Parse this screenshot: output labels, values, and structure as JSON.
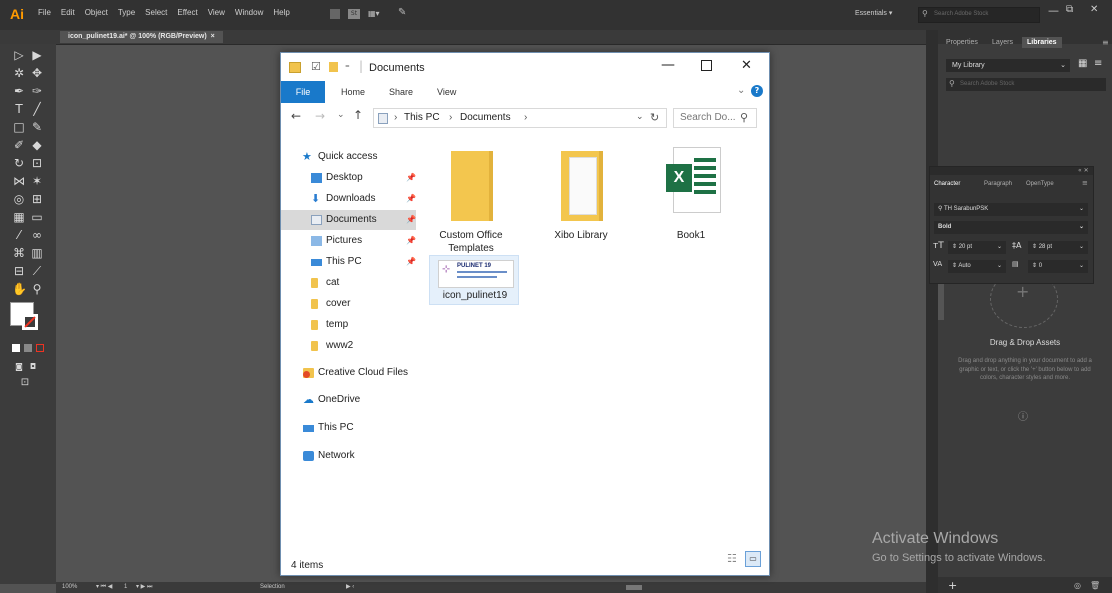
{
  "illustrator": {
    "logo": "Ai",
    "menu": [
      "File",
      "Edit",
      "Object",
      "Type",
      "Select",
      "Effect",
      "View",
      "Window",
      "Help"
    ],
    "workspace": "Essentials",
    "stock_search_placeholder": "Search Adobe Stock",
    "doc_tab": "icon_pulinet19.ai* @ 100% (RGB/Preview)",
    "doc_tab_close": "×",
    "status": {
      "zoom": "100%",
      "artboard": "1",
      "mode": "Selection"
    }
  },
  "right_panel": {
    "tabs": [
      "Properties",
      "Layers",
      "Libraries"
    ],
    "library_name": "My Library",
    "library_search_placeholder": "Search Adobe Stock",
    "char_tabs": [
      "Character",
      "Paragraph",
      "OpenType"
    ],
    "font_name": "TH SarabunPSK",
    "font_style": "Bold",
    "font_size": "20 pt",
    "leading": "28 pt",
    "kerning": "Auto",
    "tracking": "0",
    "drag_title": "Drag & Drop Assets",
    "drag_text": "Drag and drop anything in your document to add a graphic or text, or click the '+' button below to add colors, character styles and more."
  },
  "explorer": {
    "title": "Documents",
    "ribbon_tabs": [
      "File",
      "Home",
      "Share",
      "View"
    ],
    "address": [
      "This PC",
      "Documents"
    ],
    "search_placeholder": "Search Do...",
    "nav": [
      {
        "label": "Quick access",
        "icon": "star-icon",
        "pinned": false
      },
      {
        "label": "Desktop",
        "icon": "desktop-folder-icon",
        "pinned": true
      },
      {
        "label": "Downloads",
        "icon": "downloads-folder-icon",
        "pinned": true
      },
      {
        "label": "Documents",
        "icon": "documents-folder-icon",
        "pinned": true,
        "selected": true
      },
      {
        "label": "Pictures",
        "icon": "pictures-folder-icon",
        "pinned": true
      },
      {
        "label": "This PC",
        "icon": "this-pc-icon",
        "pinned": true
      },
      {
        "label": "cat",
        "icon": "folder-icon",
        "pinned": false
      },
      {
        "label": "cover",
        "icon": "folder-icon",
        "pinned": false
      },
      {
        "label": "temp",
        "icon": "folder-icon",
        "pinned": false
      },
      {
        "label": "www2",
        "icon": "folder-icon",
        "pinned": false
      },
      {
        "label": "Creative Cloud Files",
        "icon": "creative-cloud-icon",
        "pinned": false
      },
      {
        "label": "OneDrive",
        "icon": "onedrive-icon",
        "pinned": false
      },
      {
        "label": "This PC",
        "icon": "this-pc-icon",
        "pinned": false
      },
      {
        "label": "Network",
        "icon": "network-icon",
        "pinned": false
      }
    ],
    "files": [
      {
        "label": "Custom Office Templates",
        "icon": "folder-icon"
      },
      {
        "label": "Xibo Library",
        "icon": "folder-stack-icon"
      },
      {
        "label": "Book1",
        "icon": "excel-icon"
      },
      {
        "label": "icon_pulinet19",
        "icon": "image-thumbnail-icon"
      }
    ],
    "thumbnail_title": "PULINET 19",
    "excel_letter": "X",
    "item_count": "4 items"
  },
  "watermark": {
    "title": "Activate Windows",
    "subtitle": "Go to Settings to activate Windows."
  },
  "colors": {
    "accent": "#1979ca",
    "folder": "#f1c34d",
    "excel": "#1e7145",
    "ai_orange": "#ff9a00"
  }
}
